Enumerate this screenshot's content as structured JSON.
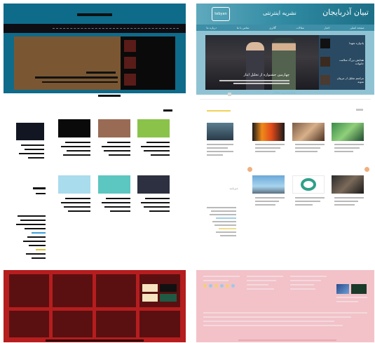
{
  "real_page": {
    "site_name": "تبیان آذربایجان",
    "header_motto": "نشریه اینترنتی",
    "logo_badge": "tebyan",
    "nav_items": [
      "صفحه اصلی",
      "اخبار",
      "مقالات",
      "گالری",
      "تماس با ما",
      "درباره ما"
    ],
    "hero_caption": "چهارمین جشنواره از تجلیل ایثار",
    "slider_items": [
      "یادواره شهدا",
      "همایش بزرگ سلامت خانواده",
      "مراسم تجلیل از مربیان نمونه"
    ],
    "section_heading": "پربازدیدترین مطالب",
    "sidebar_title": "خبرنامه",
    "colors": {
      "header_teal": "#1d6f86",
      "footer_pink": "#f2c2c8",
      "accent_orange": "#f0b07e"
    }
  },
  "wireframe": {
    "colors": {
      "header": "#0f6b8a",
      "banner": "#7a5732",
      "footer": "#b51d1f",
      "footer_cell": "#5a1010",
      "tile_dark": "#121622",
      "tile_black": "#0a0a0a",
      "tile_brown": "#9a6b54",
      "tile_green": "#8bc34a",
      "tile_lightblue": "#a9dced",
      "tile_teal": "#5cc6c1",
      "tile_navy": "#2c3040"
    }
  }
}
